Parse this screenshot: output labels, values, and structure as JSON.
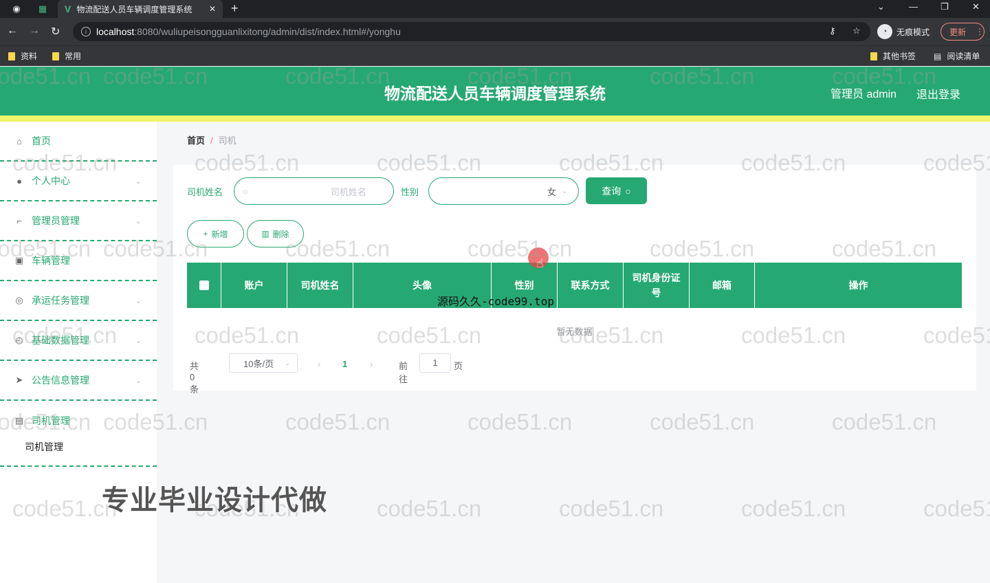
{
  "browser": {
    "tab_title": "物流配送人员车辆调度管理系统",
    "url_host": "localhost",
    "url_path": ":8080/wuliupeisongguanlixitong/admin/dist/index.html#/yonghu",
    "incognito_label": "无痕模式",
    "update_label": "更新",
    "bookmarks": [
      "资料",
      "常用"
    ],
    "bookmarks_right": [
      "其他书签",
      "阅读清单"
    ]
  },
  "header": {
    "title": "物流配送人员车辆调度管理系统",
    "admin": "管理员 admin",
    "logout": "退出登录"
  },
  "sidebar": {
    "items": [
      {
        "label": "首页",
        "icon": "home-icon"
      },
      {
        "label": "个人中心",
        "icon": "user-icon"
      },
      {
        "label": "管理员管理",
        "icon": "crop-icon"
      },
      {
        "label": "车辆管理",
        "icon": "car-icon"
      },
      {
        "label": "承运任务管理",
        "icon": "target-icon"
      },
      {
        "label": "基础数据管理",
        "icon": "compass-icon"
      },
      {
        "label": "公告信息管理",
        "icon": "send-icon"
      },
      {
        "label": "司机管理",
        "icon": "document-icon"
      }
    ],
    "sub_item": "司机管理"
  },
  "breadcrumb": {
    "home": "首页",
    "sep": "/",
    "current": "司机"
  },
  "search": {
    "name_label": "司机姓名",
    "name_placeholder": "司机姓名",
    "gender_label": "性别",
    "gender_value": "女",
    "query_label": "查询"
  },
  "actions": {
    "add": "新增",
    "delete": "删除"
  },
  "table": {
    "headers": [
      "账户",
      "司机姓名",
      "头像",
      "性别",
      "联系方式",
      "司机身份证号",
      "邮箱",
      "操作"
    ],
    "empty_text": "暂无数据"
  },
  "pagination": {
    "total": "共 0 条",
    "page_size": "10条/页",
    "current_page": "1",
    "goto_label": "前往",
    "goto_value": "1",
    "page_suffix": "页"
  },
  "overlay": {
    "watermark": "code51.cn",
    "source_text": "源码久久-code99.top",
    "promo_text": "专业毕业设计代做"
  },
  "colors": {
    "primary": "#26a872",
    "strip": "#eef56b"
  }
}
